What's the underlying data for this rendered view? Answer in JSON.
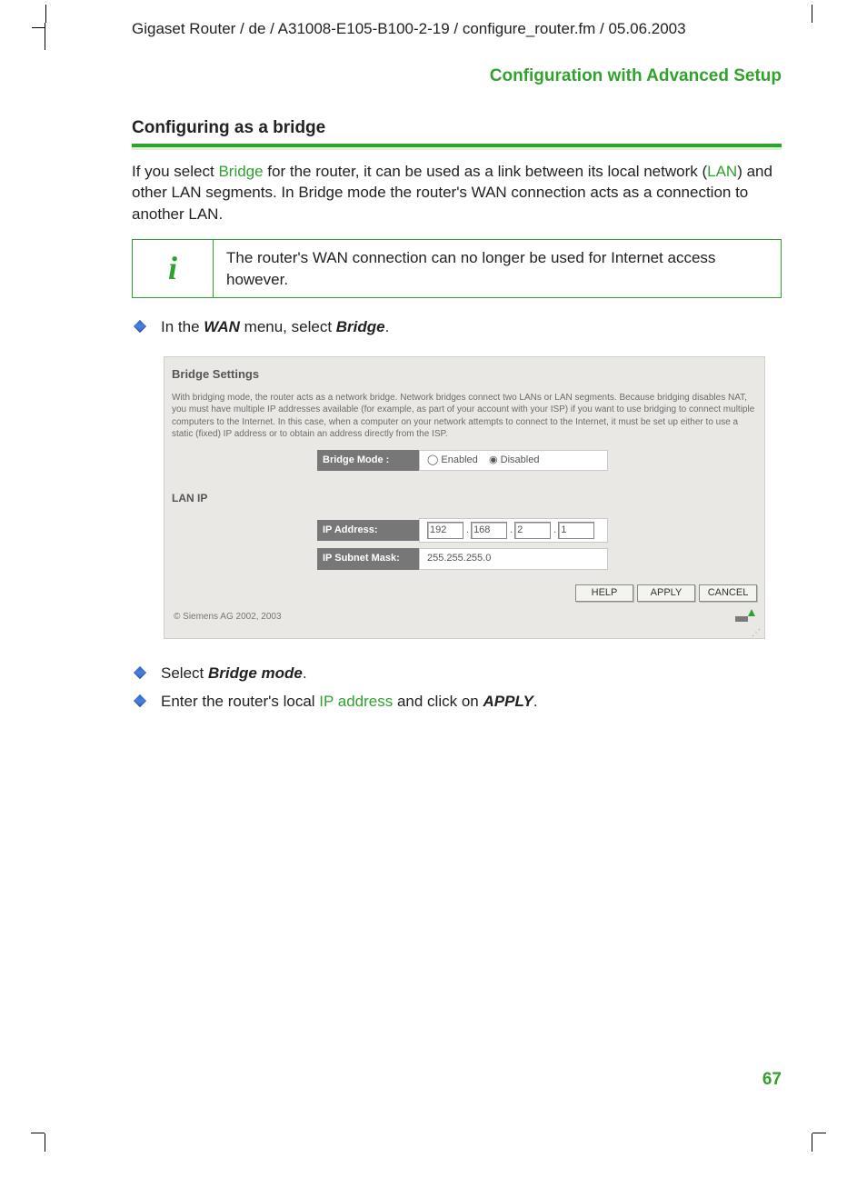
{
  "header_path": "Gigaset Router / de / A31008-E105-B100-2-19 / configure_router.fm / 05.06.2003",
  "doc_title": "Configuration with Advanced Setup",
  "section_heading": "Configuring as a bridge",
  "intro_parts": {
    "a": "If you select ",
    "bridge": "Bridge",
    "b": " for the router, it can be used as a link between its local network (",
    "lan": "LAN",
    "c": ") and other LAN segments. In Bridge mode the router's WAN connection acts as a connection to another LAN."
  },
  "info_note": "The router's WAN connection can no longer be used for Internet access however.",
  "step1": {
    "a": "In the ",
    "b": "WAN",
    "c": " menu, select ",
    "d": "Bridge",
    "e": "."
  },
  "screenshot": {
    "panel_title": "Bridge Settings",
    "description": "With bridging mode, the router acts as a network bridge. Network bridges connect two LANs or LAN segments. Because bridging disables NAT, you must have multiple IP addresses available (for example, as part of your account with your ISP) if you want to use bridging to connect multiple computers to the Internet. In this case, when a computer on your network attempts to connect to the Internet, it must be set up either to use a static (fixed) IP address or to obtain an address directly from the ISP.",
    "bridge_mode_label": "Bridge Mode :",
    "enabled_label": "Enabled",
    "disabled_label": "Disabled",
    "lan_ip_heading": "LAN IP",
    "ip_address_label": "IP Address:",
    "ip": {
      "o1": "192",
      "o2": "168",
      "o3": "2",
      "o4": "1"
    },
    "subnet_label": "IP Subnet Mask:",
    "subnet_value": "255.255.255.0",
    "buttons": {
      "help": "HELP",
      "apply": "APPLY",
      "cancel": "CANCEL"
    },
    "copyright": "© Siemens AG 2002, 2003"
  },
  "step2": {
    "a": "Select ",
    "b": "Bridge mode",
    "c": "."
  },
  "step3": {
    "a": "Enter the router's local ",
    "b": "IP address",
    "c": " and click on ",
    "d": "APPLY",
    "e": "."
  },
  "page_number": "67"
}
